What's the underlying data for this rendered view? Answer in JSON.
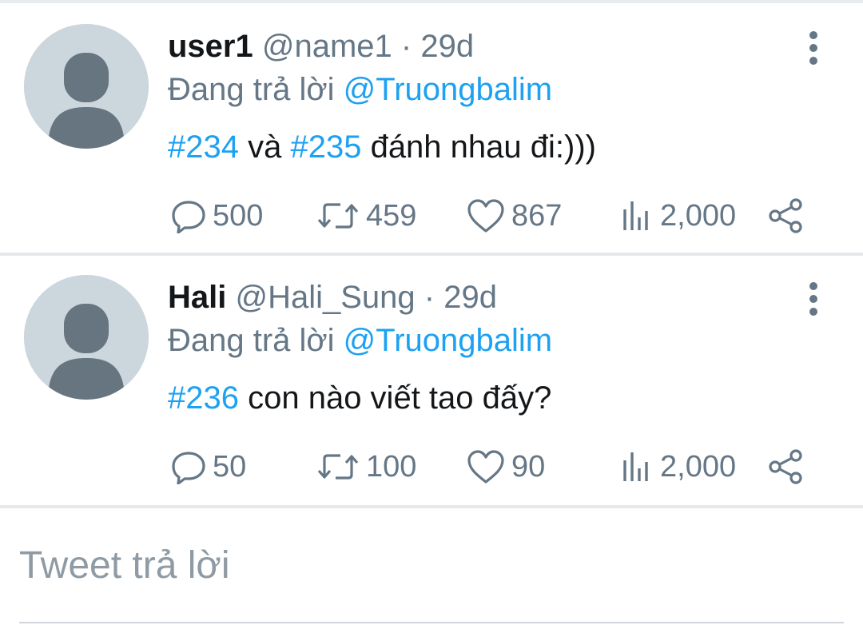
{
  "tweets": [
    {
      "author_name": "user1",
      "handle": "@name1",
      "separator": "·",
      "time": "29d",
      "reply_prefix": "Đang trả lời ",
      "reply_to": "@Truongbalim",
      "body": [
        {
          "text": "#234",
          "type": "hashtag"
        },
        {
          "text": " và ",
          "type": "text"
        },
        {
          "text": "#235",
          "type": "hashtag"
        },
        {
          "text": " đánh nhau đi:)))",
          "type": "text"
        }
      ],
      "stats": {
        "replies": "500",
        "retweets": "459",
        "likes": "867",
        "views": "2,000"
      }
    },
    {
      "author_name": "Hali",
      "handle": "@Hali_Sung",
      "separator": "·",
      "time": "29d",
      "reply_prefix": "Đang trả lời ",
      "reply_to": "@Truongbalim",
      "body": [
        {
          "text": "#236",
          "type": "hashtag"
        },
        {
          "text": " con nào viết tao đấy?",
          "type": "text"
        }
      ],
      "stats": {
        "replies": "50",
        "retweets": "100",
        "likes": "90",
        "views": "2,000"
      }
    }
  ],
  "composer": {
    "placeholder": "Tweet trả lời"
  },
  "icons": {
    "avatar": "default-avatar-icon",
    "more": "more-vertical-icon",
    "reply": "reply-icon",
    "retweet": "retweet-icon",
    "like": "heart-icon",
    "views": "views-icon",
    "share": "share-icon"
  },
  "colors": {
    "accent": "#1da1f2",
    "secondary_text": "#657786",
    "primary_text": "#14171a",
    "avatar_bg": "#ccd6dd",
    "avatar_fg": "#66757f"
  }
}
